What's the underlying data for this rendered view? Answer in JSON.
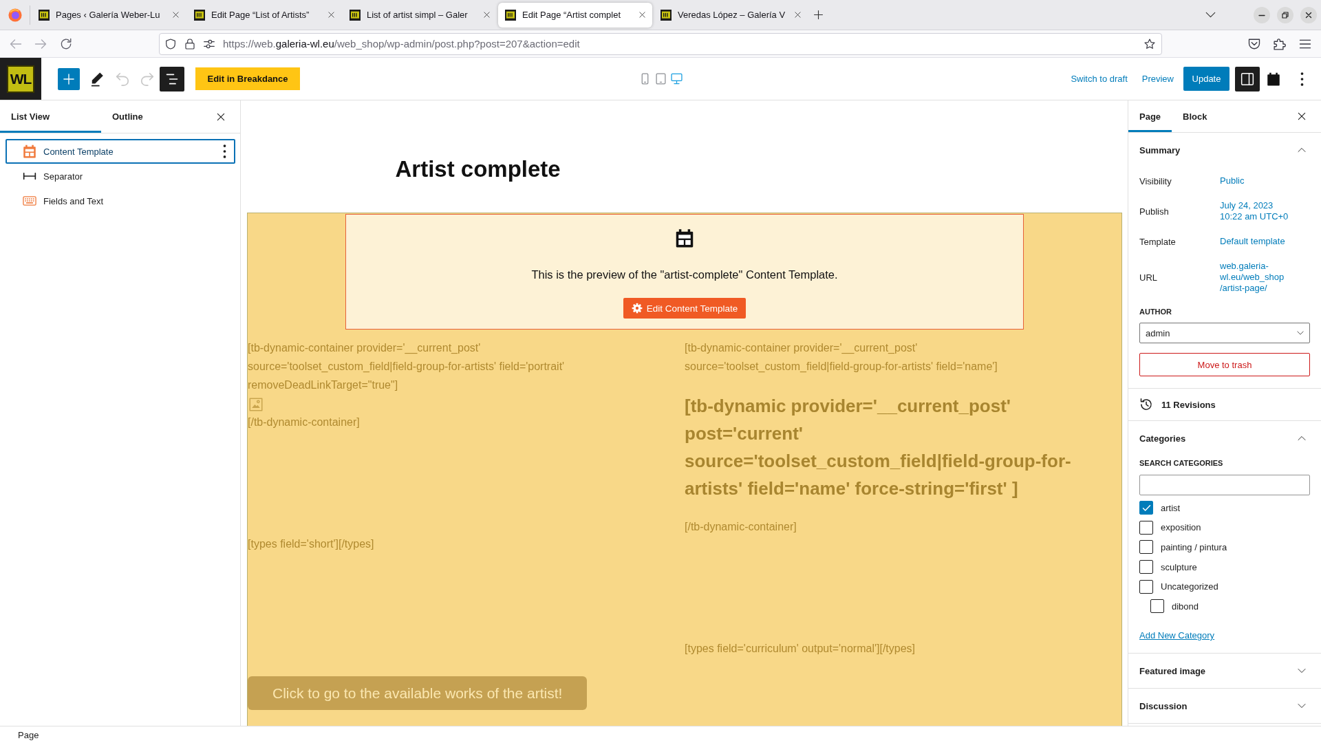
{
  "browser": {
    "tabs": [
      {
        "title": "Pages ‹ Galería Weber-Lu",
        "selected": false
      },
      {
        "title": "Edit Page “List of Artists”",
        "selected": false
      },
      {
        "title": "List of artist simpl – Galer",
        "selected": false
      },
      {
        "title": "Edit Page “Artist complet",
        "selected": true
      },
      {
        "title": "Veredas López – Galería V",
        "selected": false
      }
    ],
    "url": "https://web.**galeria-wl.eu**/web_shop/wp-admin/post.php?post=207&action=edit"
  },
  "editor_header": {
    "logo": "WL",
    "undo": {
      "disabled": true
    },
    "redo": {
      "disabled": true
    },
    "list_view_toggle": {
      "pressed": true
    },
    "builder_button": "Edit in Breakdance",
    "devices": [
      {
        "kind": "mobile",
        "selected": false
      },
      {
        "kind": "tablet",
        "selected": false
      },
      {
        "kind": "desktop",
        "selected": true
      }
    ],
    "links": [
      "Switch to draft",
      "Preview"
    ],
    "update_button": "Update",
    "settings_toggle": {
      "pressed": true
    }
  },
  "list_view": {
    "tabs": [
      {
        "label": "List View",
        "selected": true
      },
      {
        "label": "Outline",
        "selected": false
      }
    ],
    "items": [
      {
        "kind": "template",
        "label": "Content Template",
        "selected": true
      },
      {
        "kind": "separator",
        "label": "Separator",
        "selected": false
      },
      {
        "kind": "fields",
        "label": "Fields and Text",
        "selected": false
      }
    ]
  },
  "canvas": {
    "title": "Artist complete",
    "template_preview": {
      "message": "This is the preview of the \"artist-complete\" Content Template.",
      "button": "Edit Content Template"
    },
    "columns": [
      [
        {
          "kind": "shortcode",
          "text": "[tb-dynamic-container provider='__current_post' source='toolset_custom_field|field-group-for-artists' field='portrait' removeDeadLinkTarget=\"true\"]"
        },
        {
          "kind": "image"
        },
        {
          "kind": "shortcode",
          "text": "[/tb-dynamic-container]"
        },
        {
          "kind": "field",
          "text": "[types field='short'][/types]"
        }
      ],
      [
        {
          "kind": "shortcode",
          "text": "[tb-dynamic-container provider='__current_post' source='toolset_custom_field|field-group-for-artists' field='name']"
        },
        {
          "kind": "heading",
          "text": "[tb-dynamic provider='__current_post' post='current' source='toolset_custom_field|field-group-for-artists' field='name' force-string='first' ]"
        },
        {
          "kind": "shortcode",
          "text": "[/tb-dynamic-container]"
        },
        {
          "kind": "field",
          "text": "[types field='curriculum' output='normal'][/types]"
        }
      ]
    ],
    "works_button": "Click to go to the available works of the artist!"
  },
  "settings": {
    "tabs": [
      {
        "label": "Page",
        "selected": true
      },
      {
        "label": "Block",
        "selected": false
      }
    ],
    "summary": {
      "title": "Summary",
      "expanded": true,
      "rows": [
        {
          "label": "Visibility",
          "value": [
            "Public"
          ]
        },
        {
          "label": "Publish",
          "value": [
            "July 24, 2023",
            "10:22 am UTC+0"
          ]
        },
        {
          "label": "Template",
          "value": [
            "Default template"
          ]
        },
        {
          "label": "URL",
          "value": [
            "web.galeria-",
            "wl.eu/web_shop",
            "/artist-page/"
          ]
        }
      ],
      "author_label": "AUTHOR",
      "author": "admin",
      "trash_button": "Move to trash"
    },
    "revisions": "11 Revisions",
    "categories": {
      "title": "Categories",
      "expanded": true,
      "search_label": "SEARCH CATEGORIES",
      "items": [
        {
          "label": "artist",
          "checked": true
        },
        {
          "label": "exposition",
          "checked": false
        },
        {
          "label": "painting / pintura",
          "checked": false
        },
        {
          "label": "sculpture",
          "checked": false
        },
        {
          "label": "Uncategorized",
          "checked": false,
          "children": [
            {
              "label": "dibond",
              "checked": false
            }
          ]
        }
      ],
      "add_link": "Add New Category"
    },
    "panels": [
      {
        "title": "Featured image",
        "expanded": false
      },
      {
        "title": "Discussion",
        "expanded": false
      }
    ]
  },
  "status_bar": {
    "breadcrumb": "Page"
  }
}
